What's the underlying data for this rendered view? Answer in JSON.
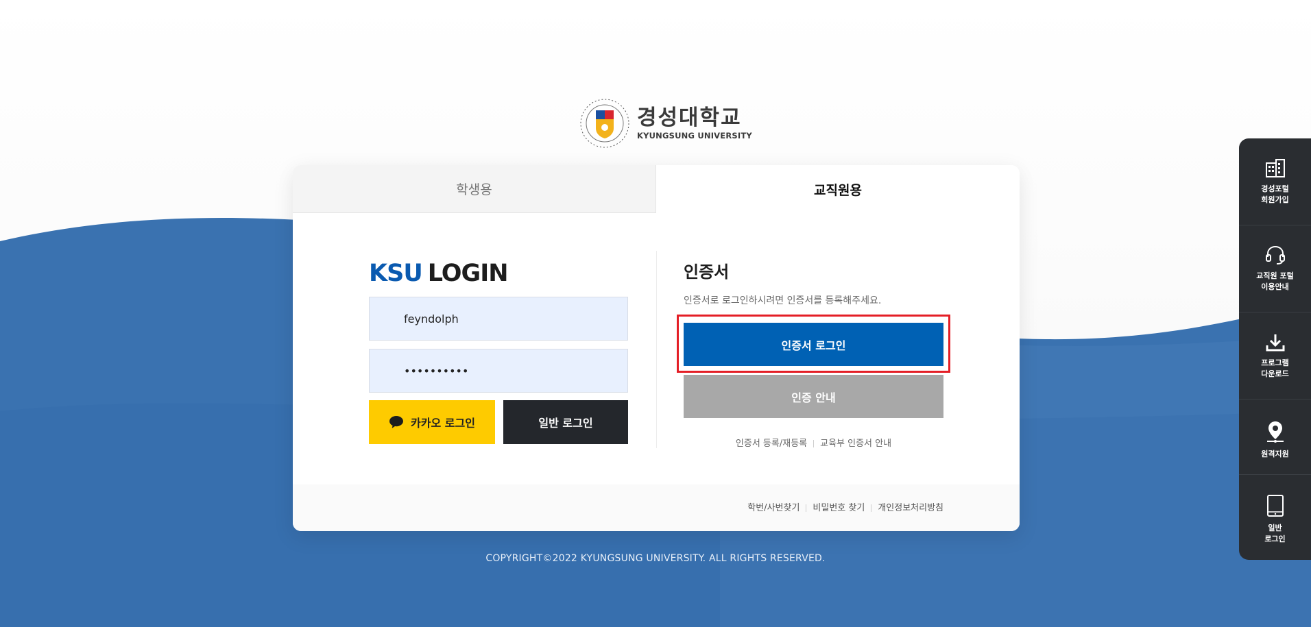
{
  "logo": {
    "name_ko": "경성대학교",
    "name_en": "KYUNGSUNG UNIVERSITY",
    "seal_icon": "university-seal-icon"
  },
  "tabs": [
    {
      "label": "학생용",
      "active": false
    },
    {
      "label": "교직원용",
      "active": true
    }
  ],
  "login": {
    "title_brand": "KSU",
    "title_word": "LOGIN",
    "username_value": "feyndolph",
    "password_value": "••••••••••",
    "kakao_label": "카카오 로그인",
    "normal_label": "일반 로그인"
  },
  "cert": {
    "title": "인증서",
    "description": "인증서로 로그인하시려면 인증서를 등록해주세요.",
    "login_label": "인증서 로그인",
    "guide_label": "인증 안내",
    "links": [
      "인증서 등록/재등록",
      "교육부 인증서 안내"
    ]
  },
  "footer_links": [
    "학번/사번찾기",
    "비밀번호 찾기",
    "개인정보처리방침"
  ],
  "copyright": "COPYRIGHT©2022 KYUNGSUNG UNIVERSITY. ALL RIGHTS RESERVED.",
  "quick_menu": [
    {
      "label": "경성포털\n회원가입",
      "icon": "building-icon"
    },
    {
      "label": "교직원 포털\n이용안내",
      "icon": "headset-icon"
    },
    {
      "label": "프로그램\n다운로드",
      "icon": "download-icon"
    },
    {
      "label": "원격지원",
      "icon": "location-pin-icon"
    },
    {
      "label": "일반\n로그인",
      "icon": "tablet-icon"
    }
  ],
  "colors": {
    "brand_blue": "#0061b4",
    "kakao_yellow": "#fecb00",
    "dark_button": "#24272c",
    "guide_gray": "#a8a8a8",
    "highlight_red": "#e41e26",
    "wave_blue": "#3a72b0",
    "quick_menu_bg": "#2a2d31"
  }
}
